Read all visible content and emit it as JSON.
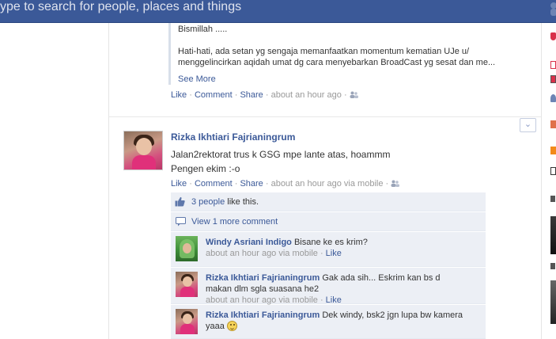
{
  "topbar": {
    "search_placeholder": "ype to search for people, places and things"
  },
  "story1": {
    "shared_line1": "Bismillah .....",
    "shared_line2": "Hati-hati, ada setan yg sengaja memanfaatkan momentum kematian UJe u/",
    "shared_line3": "menggelincirkan aqidah umat dg cara menyebarkan BroadCast yg sesat dan me...",
    "see_more": "See More",
    "actions": {
      "like": "Like",
      "comment": "Comment",
      "share": "Share",
      "time": "about an hour ago",
      "sep": " · "
    }
  },
  "story2": {
    "author": "Rizka Ikhtiari Fajrianingrum",
    "message_line1": "Jalan2rektorat trus k GSG mpe lante atas, hoammm",
    "message_line2": "Pengen ekim :-o",
    "actions": {
      "like": "Like",
      "comment": "Comment",
      "share": "Share",
      "time": "about an hour ago via mobile"
    },
    "chevron": "⌄",
    "likes": {
      "count_link": "3 people",
      "suffix": " like this."
    },
    "view_more": "View 1 more comment",
    "comments": [
      {
        "author": "Windy Asriani Indigo",
        "text": "Bisane ke es krim?",
        "meta": "about an hour ago via mobile",
        "like": "Like"
      },
      {
        "author": "Rizka Ikhtiari Fajrianingrum",
        "text": "Gak ada sih... Eskrim kan bs d",
        "text2": "makan dlm sgla suasana he2",
        "meta": "about an hour ago via mobile",
        "like": "Like"
      },
      {
        "author": "Rizka Ikhtiari Fajrianingrum",
        "text": "Dek windy, bsk2 jgn lupa bw kamera",
        "text2": "yaaa"
      }
    ]
  },
  "colors": {
    "brand": "#3b5998",
    "comment_bg": "#eceff5",
    "meta_gray": "#999999"
  },
  "icons": {
    "friends": "friends-icon",
    "thumbs_up": "thumbs-up-icon",
    "comment_bubble": "comment-bubble-icon",
    "smiley": "smiley-emoticon-icon"
  }
}
